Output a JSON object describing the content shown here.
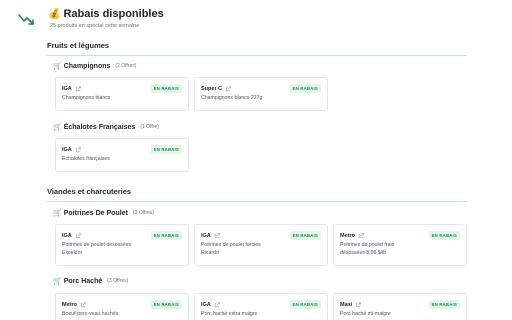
{
  "header": {
    "title": "Rabais disponibles",
    "title_icon": "money-bag-icon",
    "subtitle": "25 produits en spécial cette semaine",
    "logo": "trend-line-icon"
  },
  "sections": [
    {
      "title": "Fruits et légumes",
      "groups": [
        {
          "title": "Champignons",
          "count": "(2 Offres)",
          "offers": [
            {
              "store": "IGA",
              "badge": "EN RABAIS",
              "product": "Champignons blancs"
            },
            {
              "store": "Super C",
              "badge": "EN RABAIS",
              "product": "Champignons blancs 227g"
            }
          ]
        },
        {
          "title": "Échalotes Françaises",
          "count": "(1 Offre)",
          "offers": [
            {
              "store": "IGA",
              "badge": "EN RABAIS",
              "product": "Échalotes françaises"
            }
          ]
        }
      ]
    },
    {
      "title": "Viandes et charcuteries",
      "groups": [
        {
          "title": "Poitrines De Poulet",
          "count": "(3 Offres)",
          "offers": [
            {
              "store": "IGA",
              "badge": "EN RABAIS",
              "product": "Poitrines de poulet désossées",
              "product2": "Exceldor"
            },
            {
              "store": "IGA",
              "badge": "EN RABAIS",
              "product": "Poitrines de poulet farcies",
              "product2": "Ricardo"
            },
            {
              "store": "Metro",
              "badge": "EN RABAIS",
              "product": "Poitrines de poulet frais",
              "product2": "désossées 8,99 $/lb"
            }
          ]
        },
        {
          "title": "Porc Haché",
          "count": "(3 Offres)",
          "offers": [
            {
              "store": "Metro",
              "badge": "EN RABAIS",
              "product": "Boeuf-porc-veau hachés"
            },
            {
              "store": "IGA",
              "badge": "EN RABAIS",
              "product": "Porc haché extra maigre"
            },
            {
              "store": "Maxi",
              "badge": "EN RABAIS",
              "product": "Porc haché mi-maigre"
            }
          ]
        }
      ]
    }
  ],
  "colors": {
    "accent": "#1a8f4a",
    "badge_bg": "#e3f6ea",
    "rule": "#bfe8cf"
  }
}
